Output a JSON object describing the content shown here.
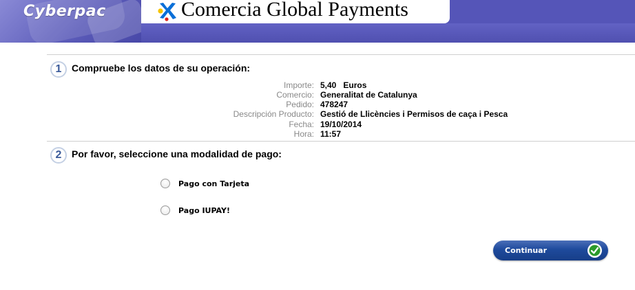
{
  "header": {
    "brand_left": "Cyberpac",
    "logo_text": "Comercia Global Payments",
    "colors": {
      "band": "#5555b8",
      "star_blue": "#0a6fd8",
      "star_yellow": "#f5c400",
      "star_red": "#e0231a"
    }
  },
  "step1": {
    "number": "1",
    "title": "Compruebe los datos de su operación:",
    "details": [
      {
        "label": "Importe:",
        "value": "5,40",
        "suffix": "Euros"
      },
      {
        "label": "Comercio:",
        "value": "Generalitat de Catalunya"
      },
      {
        "label": "Pedido:",
        "value": "478247"
      },
      {
        "label": "Descripción Producto:",
        "value": "Gestió de Llicències i Permisos de caça i Pesca"
      },
      {
        "label": "Fecha:",
        "value": "19/10/2014"
      },
      {
        "label": "Hora:",
        "value": "11:57"
      }
    ]
  },
  "step2": {
    "number": "2",
    "title": "Por favor, seleccione una modalidad de pago:",
    "options": [
      {
        "label": "Pago con Tarjeta",
        "selected": false
      },
      {
        "label": "Pago IUPAY!",
        "selected": false
      }
    ]
  },
  "continue_button": {
    "label": "Continuar",
    "icon": "check-icon",
    "color": "#1e4a9c"
  }
}
